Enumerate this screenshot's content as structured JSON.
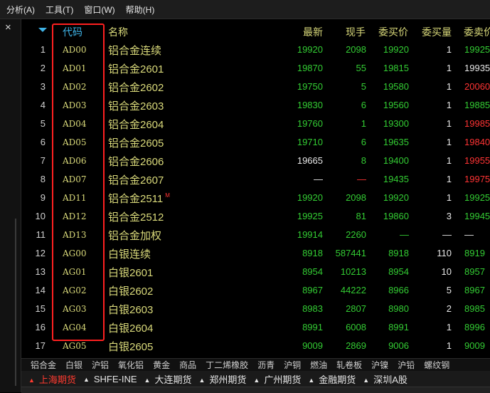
{
  "menu": [
    "分析(A)",
    "工具(T)",
    "窗口(W)",
    "帮助(H)"
  ],
  "left_close": "×",
  "table": {
    "headers": {
      "code": "代码",
      "name": "名称",
      "latest": "最新",
      "vol": "现手",
      "bid": "委买价",
      "bidq": "委买量",
      "ask": "委卖价"
    },
    "rows": [
      {
        "idx": "1",
        "code": "AD00",
        "name": "铝合金连续",
        "badge": "",
        "latest": "19920",
        "latest_c": "g",
        "vol": "2098",
        "vol_c": "g",
        "bid": "19920",
        "bid_c": "g",
        "bidq": "1",
        "ask": "19925",
        "ask_c": "g"
      },
      {
        "idx": "2",
        "code": "AD01",
        "name": "铝合金2601",
        "badge": "",
        "latest": "19870",
        "latest_c": "g",
        "vol": "55",
        "vol_c": "g",
        "bid": "19815",
        "bid_c": "g",
        "bidq": "1",
        "ask": "19935",
        "ask_c": "w"
      },
      {
        "idx": "3",
        "code": "AD02",
        "name": "铝合金2602",
        "badge": "",
        "latest": "19750",
        "latest_c": "g",
        "vol": "5",
        "vol_c": "g",
        "bid": "19580",
        "bid_c": "g",
        "bidq": "1",
        "ask": "20060",
        "ask_c": "r"
      },
      {
        "idx": "4",
        "code": "AD03",
        "name": "铝合金2603",
        "badge": "",
        "latest": "19830",
        "latest_c": "g",
        "vol": "6",
        "vol_c": "g",
        "bid": "19560",
        "bid_c": "g",
        "bidq": "1",
        "ask": "19885",
        "ask_c": "g"
      },
      {
        "idx": "5",
        "code": "AD04",
        "name": "铝合金2604",
        "badge": "",
        "latest": "19760",
        "latest_c": "g",
        "vol": "1",
        "vol_c": "g",
        "bid": "19300",
        "bid_c": "g",
        "bidq": "1",
        "ask": "19985",
        "ask_c": "r"
      },
      {
        "idx": "6",
        "code": "AD05",
        "name": "铝合金2605",
        "badge": "",
        "latest": "19710",
        "latest_c": "g",
        "vol": "6",
        "vol_c": "g",
        "bid": "19635",
        "bid_c": "g",
        "bidq": "1",
        "ask": "19840",
        "ask_c": "r"
      },
      {
        "idx": "7",
        "code": "AD06",
        "name": "铝合金2606",
        "badge": "",
        "latest": "19665",
        "latest_c": "w",
        "vol": "8",
        "vol_c": "g",
        "bid": "19400",
        "bid_c": "g",
        "bidq": "1",
        "ask": "19955",
        "ask_c": "r"
      },
      {
        "idx": "8",
        "code": "AD07",
        "name": "铝合金2607",
        "badge": "",
        "latest": "—",
        "latest_c": "w",
        "vol": "—",
        "vol_c": "r",
        "bid": "19435",
        "bid_c": "g",
        "bidq": "1",
        "ask": "19975",
        "ask_c": "r"
      },
      {
        "idx": "9",
        "code": "AD11",
        "name": "铝合金2511",
        "badge": "M",
        "latest": "19920",
        "latest_c": "g",
        "vol": "2098",
        "vol_c": "g",
        "bid": "19920",
        "bid_c": "g",
        "bidq": "1",
        "ask": "19925",
        "ask_c": "g"
      },
      {
        "idx": "10",
        "code": "AD12",
        "name": "铝合金2512",
        "badge": "",
        "latest": "19925",
        "latest_c": "g",
        "vol": "81",
        "vol_c": "g",
        "bid": "19860",
        "bid_c": "g",
        "bidq": "3",
        "ask": "19945",
        "ask_c": "g"
      },
      {
        "idx": "11",
        "code": "AD13",
        "name": "铝合金加权",
        "badge": "",
        "latest": "19914",
        "latest_c": "g",
        "vol": "2260",
        "vol_c": "g",
        "bid": "—",
        "bid_c": "g",
        "bidq": "—",
        "ask": "—",
        "ask_c": "w"
      },
      {
        "idx": "12",
        "code": "AG00",
        "name": "白银连续",
        "badge": "",
        "latest": "8918",
        "latest_c": "g",
        "vol": "587441",
        "vol_c": "g",
        "bid": "8918",
        "bid_c": "g",
        "bidq": "110",
        "ask": "8919",
        "ask_c": "g"
      },
      {
        "idx": "13",
        "code": "AG01",
        "name": "白银2601",
        "badge": "",
        "latest": "8954",
        "latest_c": "g",
        "vol": "10213",
        "vol_c": "g",
        "bid": "8954",
        "bid_c": "g",
        "bidq": "10",
        "ask": "8957",
        "ask_c": "g"
      },
      {
        "idx": "14",
        "code": "AG02",
        "name": "白银2602",
        "badge": "",
        "latest": "8967",
        "latest_c": "g",
        "vol": "44222",
        "vol_c": "g",
        "bid": "8966",
        "bid_c": "g",
        "bidq": "5",
        "ask": "8967",
        "ask_c": "g"
      },
      {
        "idx": "15",
        "code": "AG03",
        "name": "白银2603",
        "badge": "",
        "latest": "8983",
        "latest_c": "g",
        "vol": "2807",
        "vol_c": "g",
        "bid": "8980",
        "bid_c": "g",
        "bidq": "2",
        "ask": "8985",
        "ask_c": "g"
      },
      {
        "idx": "16",
        "code": "AG04",
        "name": "白银2604",
        "badge": "",
        "latest": "8991",
        "latest_c": "g",
        "vol": "6008",
        "vol_c": "g",
        "bid": "8991",
        "bid_c": "g",
        "bidq": "1",
        "ask": "8996",
        "ask_c": "g"
      },
      {
        "idx": "17",
        "code": "AG05",
        "name": "白银2605",
        "badge": "",
        "latest": "9009",
        "latest_c": "g",
        "vol": "2869",
        "vol_c": "g",
        "bid": "9006",
        "bid_c": "g",
        "bidq": "1",
        "ask": "9009",
        "ask_c": "g"
      }
    ]
  },
  "categories": [
    "铝合金",
    "白银",
    "沪铝",
    "氧化铝",
    "黄金",
    "商品",
    "丁二烯橡胶",
    "沥青",
    "沪铜",
    "燃油",
    "轧卷板",
    "沪镍",
    "沪铅",
    "螺纹钢"
  ],
  "exchanges": [
    {
      "label": "上海期货",
      "active": true
    },
    {
      "label": "SHFE-INE",
      "active": false
    },
    {
      "label": "大连期货",
      "active": false
    },
    {
      "label": "郑州期货",
      "active": false
    },
    {
      "label": "广州期货",
      "active": false
    },
    {
      "label": "金融期货",
      "active": false
    },
    {
      "label": "深圳A股",
      "active": false
    }
  ],
  "colors": {
    "green": "#33cc33",
    "red": "#ff3333",
    "yellow": "#d9d97a",
    "highlight_box": "#ff2020"
  }
}
